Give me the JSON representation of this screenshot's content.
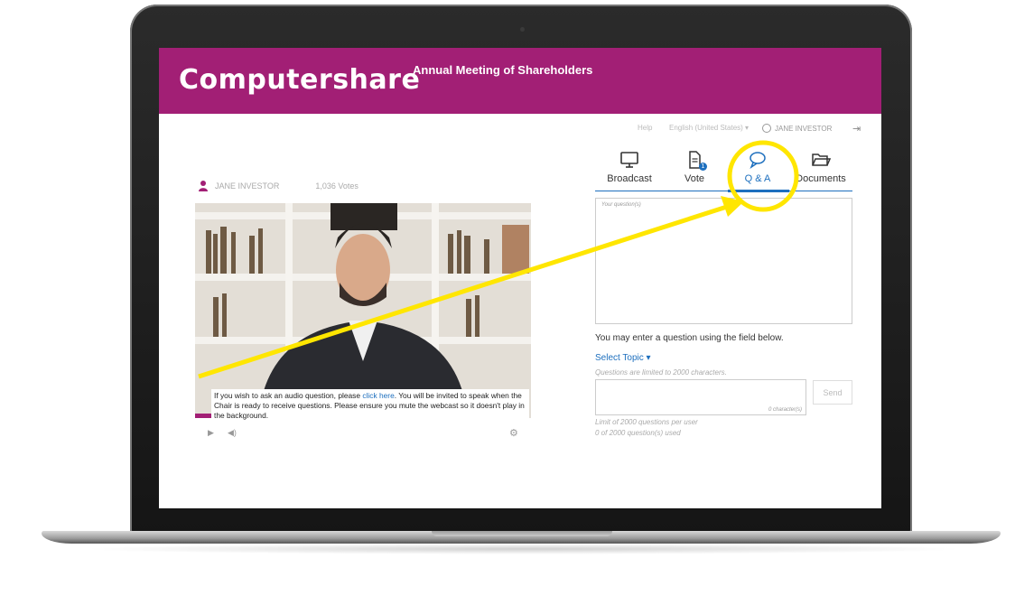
{
  "header": {
    "logo": "Computershare",
    "event_title": "Annual Meeting of Shareholders",
    "brand_color": "#a21f75"
  },
  "topbar": {
    "help": "Help",
    "language": "English (United States) ▾",
    "user": "JANE INVESTOR"
  },
  "tabs": [
    {
      "label": "Broadcast",
      "icon": "monitor-icon"
    },
    {
      "label": "Vote",
      "icon": "document-icon",
      "badge": "1"
    },
    {
      "label": "Q & A",
      "icon": "speech-bubble-icon",
      "active": true
    },
    {
      "label": "Documents",
      "icon": "folder-icon"
    }
  ],
  "left": {
    "investor_name": "JANE INVESTOR",
    "votes": "1,036 Votes",
    "notice_before_link": "If you wish to ask an audio question, please ",
    "notice_link": "click here",
    "notice_after_link": ". You will be invited to speak when the Chair is ready to receive questions. Please ensure you mute the webcast so it doesn't play in the background."
  },
  "qa": {
    "questions_label": "Your question(s)",
    "hint": "You may enter a question using the field below.",
    "select_topic": "Select Topic ▾",
    "limit_note": "Questions are limited to 2000  characters.",
    "char_count": "0 character(s)",
    "send_label": "Send",
    "limit_user": "Limit of 2000 questions per user",
    "used": "0 of 2000 question(s) used"
  },
  "colors": {
    "accent": "#1d6fbe",
    "highlight": "#ffe600"
  }
}
